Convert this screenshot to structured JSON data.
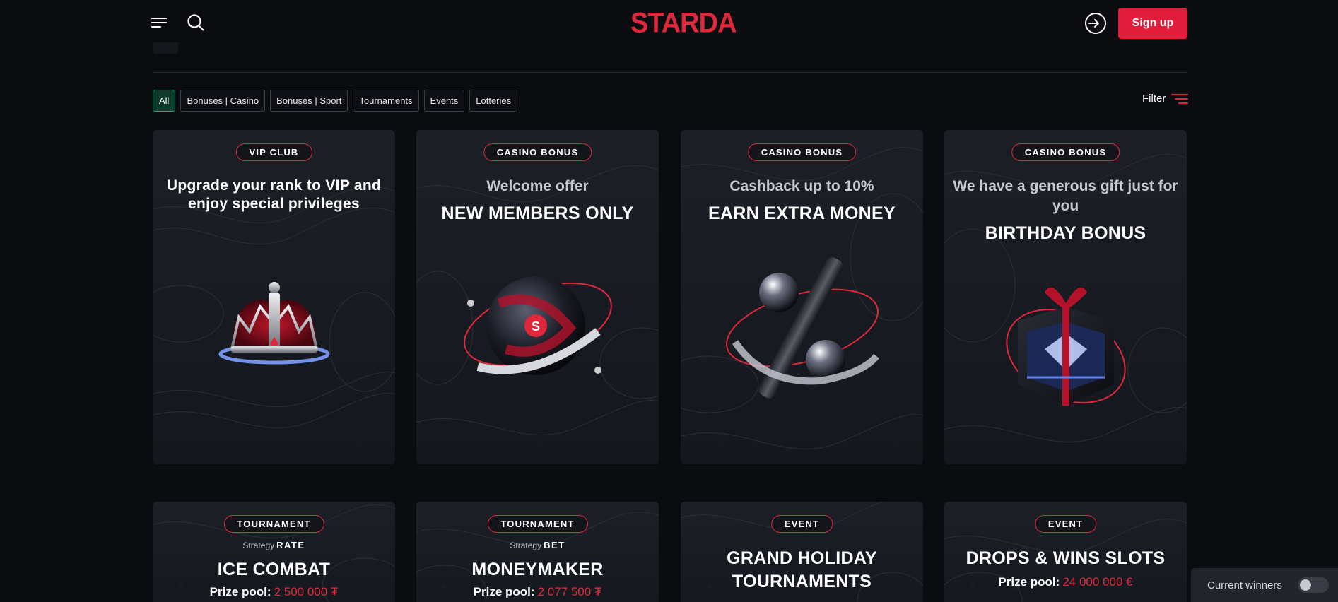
{
  "header": {
    "logo": "STARDA",
    "signup_label": "Sign up"
  },
  "filters": {
    "chips": [
      "All",
      "Bonuses | Casino",
      "Bonuses | Sport",
      "Tournaments",
      "Events",
      "Lotteries"
    ],
    "active": "All",
    "filter_label": "Filter"
  },
  "promos": [
    {
      "badge": "VIP CLUB",
      "title": "Upgrade your rank to VIP and enjoy special privileges",
      "art": "crown-image"
    },
    {
      "badge": "CASINO BONUS",
      "subtitle": "Welcome offer",
      "title": "NEW MEMBERS ONLY",
      "art": "deposit-orb-image"
    },
    {
      "badge": "CASINO BONUS",
      "subtitle": "Cashback up to 10%",
      "title": "EARN EXTRA MONEY",
      "art": "cashback-percent-image"
    },
    {
      "badge": "CASINO BONUS",
      "subtitle": "We have a generous gift just for you",
      "title": "BIRTHDAY BONUS",
      "art": "gift-box-image"
    }
  ],
  "events": [
    {
      "badge": "TOURNAMENT",
      "strategy_label": "Strategy",
      "strategy_value": "RATE",
      "title": "ICE COMBAT",
      "prize_label": "Prize pool:",
      "prize_value": "2 500 000 ₮"
    },
    {
      "badge": "TOURNAMENT",
      "strategy_label": "Strategy",
      "strategy_value": "BET",
      "title": "MONEYMAKER",
      "prize_label": "Prize pool:",
      "prize_value": "2 077 500 ₮"
    },
    {
      "badge": "EVENT",
      "title": "GRAND HOLIDAY TOURNAMENTS"
    },
    {
      "badge": "EVENT",
      "title": "DROPS & WINS SLOTS",
      "prize_label": "Prize pool:",
      "prize_value": "24 000 000 €"
    }
  ],
  "winners": {
    "label": "Current winners",
    "enabled": false
  },
  "colors": {
    "accent": "#e0283d",
    "active_chip": "#25a878",
    "background": "#0b0c10",
    "card": "#1d1f27"
  }
}
